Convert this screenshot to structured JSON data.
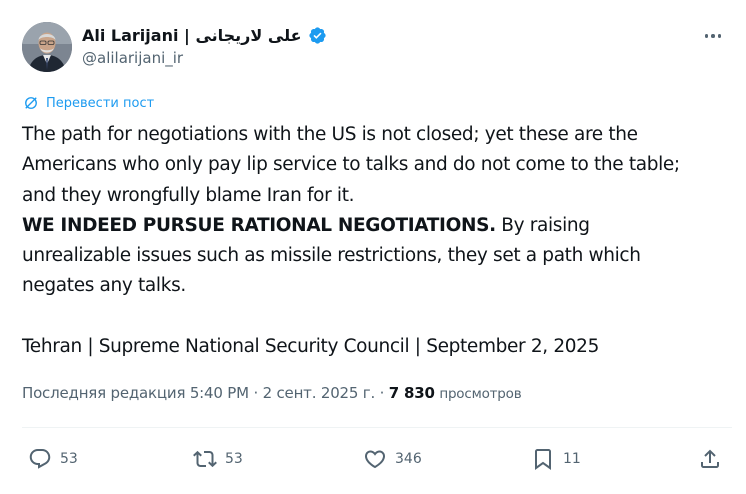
{
  "author": {
    "display_name": "Ali Larijani | علی لاریجانی",
    "handle": "@alilarijani_ir",
    "verified": true
  },
  "translate_label": "Перевести пост",
  "tweet": {
    "paragraph_1": "The path for negotiations with the US is not closed; yet these are the\nAmericans who only pay lip service to talks and do not come to the table;\nand they wrongfully blame Iran for it.",
    "bold_text": "WE INDEED PURSUE RATIONAL NEGOTIATIONS.",
    "paragraph_2_rest": " By raising\nunrealizable issues such as missile restrictions, they set a path which\nnegates any talks.",
    "signature": "Tehran | Supreme National Security Council | September 2, 2025"
  },
  "meta": {
    "edited_label": "Последняя редакция 5:40 PM · 2 сент. 2025 г. · ",
    "views_count": "7 830",
    "views_label": "просмотров"
  },
  "actions": {
    "replies": "53",
    "reposts": "53",
    "likes": "346",
    "bookmarks": "11"
  },
  "icons": [
    "verified-icon",
    "more-icon",
    "translate-icon",
    "reply-icon",
    "repost-icon",
    "like-icon",
    "bookmark-icon",
    "share-icon"
  ],
  "colors": {
    "accent": "#1d9bf0",
    "text": "#0f1419",
    "muted": "#536471"
  }
}
